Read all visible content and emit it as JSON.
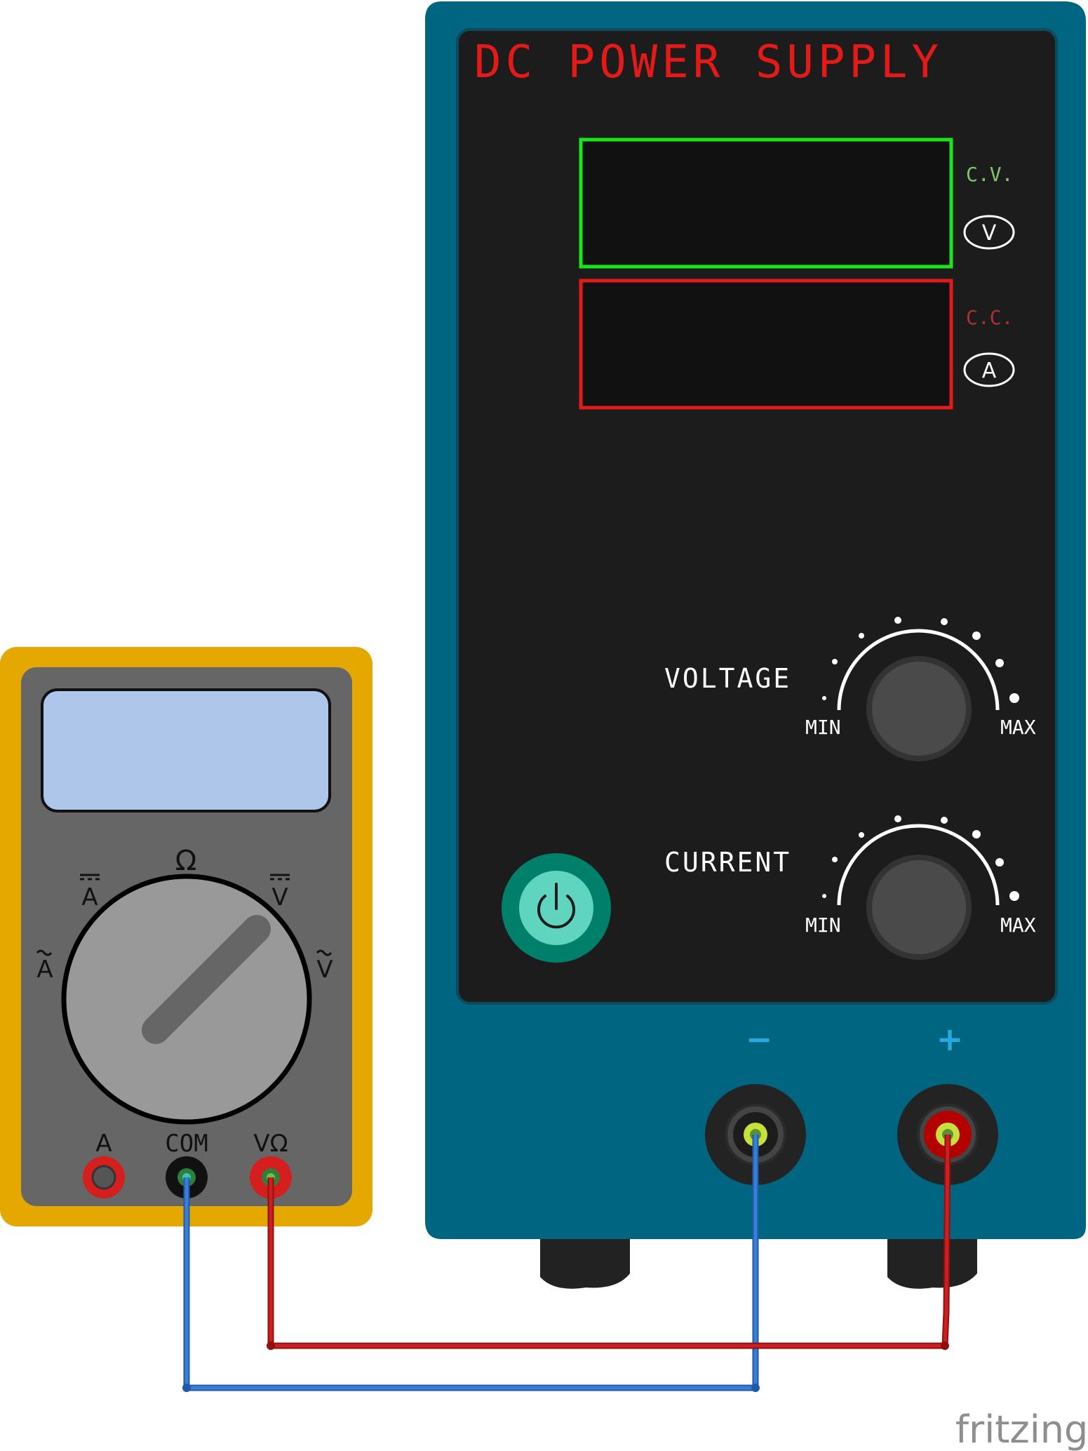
{
  "power_supply": {
    "title": "DC POWER SUPPLY",
    "cv_label": "C.V.",
    "cc_label": "C.C.",
    "voltage_unit": "V",
    "current_unit": "A",
    "voltage_knob_label": "VOLTAGE",
    "current_knob_label": "CURRENT",
    "min_label": "MIN",
    "max_label": "MAX",
    "negative_label": "−",
    "positive_label": "+",
    "cv_color": "#7ec86a",
    "cc_color": "#b03030",
    "voltage_display_color": "#19e619",
    "current_display_color": "#e61919",
    "body_color": "#006580",
    "panel_color": "#1c1c1c",
    "power_button_color": "#00806a",
    "power_icon": "power-icon"
  },
  "multimeter": {
    "mode_ohm": "Ω",
    "mode_dc_a": "A",
    "mode_dc_v": "V",
    "mode_ac_a": "A",
    "mode_ac_v": "V",
    "port_a": "A",
    "port_com": "COM",
    "port_vohm": "VΩ",
    "body_color": "#e5a800",
    "face_color": "#666666",
    "screen_color": "#aec6ea"
  },
  "wires": {
    "positive_color": "#cc1f1f",
    "negative_color": "#3a7fd6"
  },
  "watermark": "fritzing"
}
